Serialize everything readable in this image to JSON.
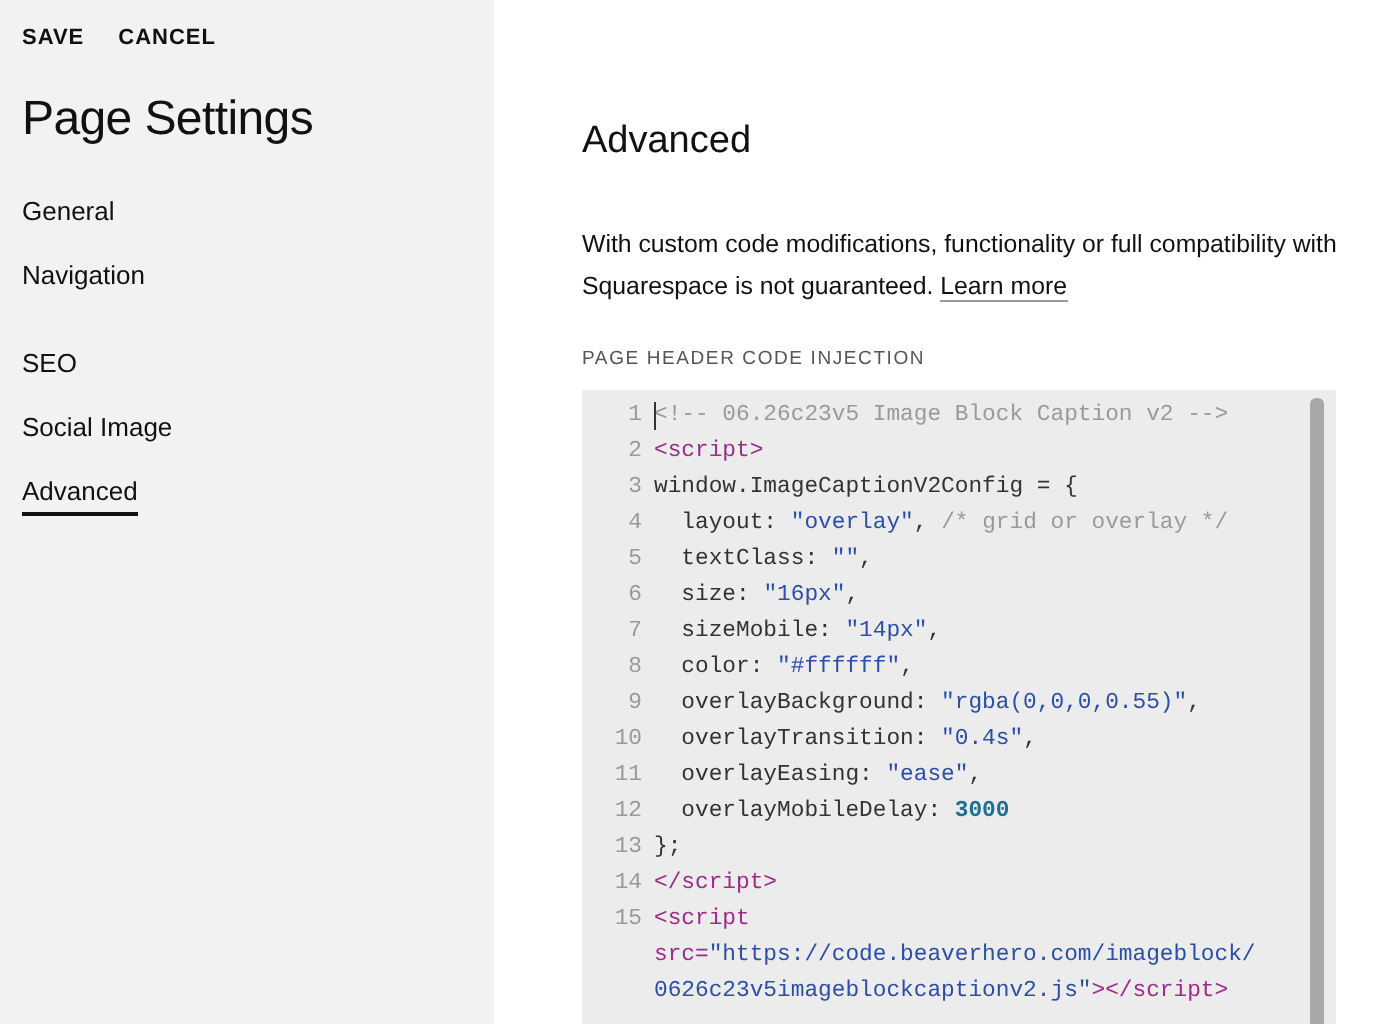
{
  "actions": [
    "SAVE",
    "CANCEL"
  ],
  "sidebar": {
    "title": "Page Settings",
    "groups": [
      [
        {
          "label": "General",
          "selected": false
        },
        {
          "label": "Navigation",
          "selected": false
        }
      ],
      [
        {
          "label": "SEO",
          "selected": false
        },
        {
          "label": "Social Image",
          "selected": false
        },
        {
          "label": "Advanced",
          "selected": true
        }
      ]
    ]
  },
  "main": {
    "title": "Advanced",
    "description_lines": [
      "With custom code modifications, functionality or full compatibility with",
      "Squarespace is not guaranteed."
    ],
    "link": "Learn more",
    "field_label": "PAGE HEADER CODE INJECTION",
    "code_lines": [
      {
        "number": "1",
        "cursor": true,
        "tokens": [
          {
            "kind": "comment",
            "text": "<!-- 06.26c23v5 Image Block Caption v2 -->"
          }
        ]
      },
      {
        "number": "2",
        "tokens": [
          {
            "kind": "tag",
            "text": "<script>"
          }
        ]
      },
      {
        "number": "3",
        "tokens": [
          {
            "kind": "plain",
            "text": "window.ImageCaptionV2Config = {"
          }
        ]
      },
      {
        "number": "4",
        "tokens": [
          {
            "kind": "plain",
            "text": "  layout: "
          },
          {
            "kind": "string",
            "text": "\"overlay\""
          },
          {
            "kind": "plain",
            "text": ", "
          },
          {
            "kind": "comment",
            "text": "/* grid or overlay */"
          }
        ]
      },
      {
        "number": "5",
        "tokens": [
          {
            "kind": "plain",
            "text": "  textClass: "
          },
          {
            "kind": "string",
            "text": "\"\""
          },
          {
            "kind": "plain",
            "text": ","
          }
        ]
      },
      {
        "number": "6",
        "tokens": [
          {
            "kind": "plain",
            "text": "  size: "
          },
          {
            "kind": "string",
            "text": "\"16px\""
          },
          {
            "kind": "plain",
            "text": ","
          }
        ]
      },
      {
        "number": "7",
        "tokens": [
          {
            "kind": "plain",
            "text": "  sizeMobile: "
          },
          {
            "kind": "string",
            "text": "\"14px\""
          },
          {
            "kind": "plain",
            "text": ","
          }
        ]
      },
      {
        "number": "8",
        "tokens": [
          {
            "kind": "plain",
            "text": "  color: "
          },
          {
            "kind": "string",
            "text": "\"#ffffff\""
          },
          {
            "kind": "plain",
            "text": ","
          }
        ]
      },
      {
        "number": "9",
        "tokens": [
          {
            "kind": "plain",
            "text": "  overlayBackground: "
          },
          {
            "kind": "string",
            "text": "\"rgba(0,0,0,0.55)\""
          },
          {
            "kind": "plain",
            "text": ","
          }
        ]
      },
      {
        "number": "10",
        "tokens": [
          {
            "kind": "plain",
            "text": "  overlayTransition: "
          },
          {
            "kind": "string",
            "text": "\"0.4s\""
          },
          {
            "kind": "plain",
            "text": ","
          }
        ]
      },
      {
        "number": "11",
        "tokens": [
          {
            "kind": "plain",
            "text": "  overlayEasing: "
          },
          {
            "kind": "string",
            "text": "\"ease\""
          },
          {
            "kind": "plain",
            "text": ","
          }
        ]
      },
      {
        "number": "12",
        "tokens": [
          {
            "kind": "plain",
            "text": "  overlayMobileDelay: "
          },
          {
            "kind": "number",
            "text": "3000"
          }
        ]
      },
      {
        "number": "13",
        "tokens": [
          {
            "kind": "plain",
            "text": "};"
          }
        ]
      },
      {
        "number": "14",
        "tokens": [
          {
            "kind": "tag",
            "text": "</script>"
          }
        ]
      },
      {
        "number": "15",
        "tokens": [
          {
            "kind": "tag",
            "text": "<script"
          }
        ]
      },
      {
        "tokens": [
          {
            "kind": "attr",
            "text": "src="
          },
          {
            "kind": "string",
            "text": "\"https://code.beaverhero.com/imageblock/"
          }
        ]
      },
      {
        "tokens": [
          {
            "kind": "string",
            "text": "0626c23v5imageblockcaptionv2.js\""
          },
          {
            "kind": "tag",
            "text": "></script>"
          }
        ]
      }
    ]
  }
}
